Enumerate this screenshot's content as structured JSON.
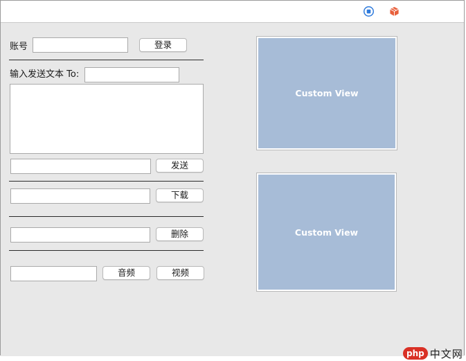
{
  "titlebar": {
    "icons": [
      "stop-record-icon",
      "package-icon"
    ]
  },
  "login": {
    "account_label": "账号",
    "account_value": "",
    "login_button": "登录"
  },
  "send": {
    "input_label": "输入发送文本 To:",
    "to_value": "",
    "message_text": "",
    "send_field_value": "",
    "send_button": "发送"
  },
  "download": {
    "field_value": "",
    "button": "下载"
  },
  "delete": {
    "field_value": "",
    "button": "删除"
  },
  "media": {
    "field_value": "",
    "audio_button": "音频",
    "video_button": "视频"
  },
  "views": {
    "top_label": "Custom View",
    "bottom_label": "Custom View"
  },
  "watermark": {
    "badge": "php",
    "text": "中文网"
  },
  "colors": {
    "custom_view_bg": "#a7bcd7",
    "record_icon": "#2f7bdc",
    "package_icon": "#e8603c"
  }
}
